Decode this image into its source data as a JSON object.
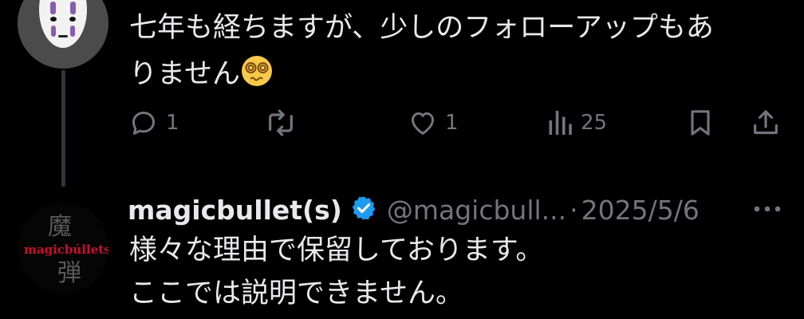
{
  "tweet1": {
    "text_line1": "七年も経ちますが、少しのフォローアップもあ",
    "text_line2": "りません",
    "emoji": "dizzy-face-emoji",
    "actions": {
      "replies": "1",
      "reposts": "",
      "likes": "1",
      "views": "25"
    }
  },
  "tweet2": {
    "name": "magicbullet(s)",
    "handle": "@magicbull...",
    "separator": "·",
    "date": "2025/5/6",
    "more": "···",
    "avatar_text": "magicbúllets",
    "text_line1": "様々な理由で保留しております。",
    "text_line2": "ここでは説明できません。"
  },
  "colors": {
    "background": "#000000",
    "text": "#e7e9ea",
    "muted": "#71767b",
    "verified": "#1d9bf0",
    "thread_line": "#33363a",
    "avatar_logo_red": "#c8102e"
  }
}
